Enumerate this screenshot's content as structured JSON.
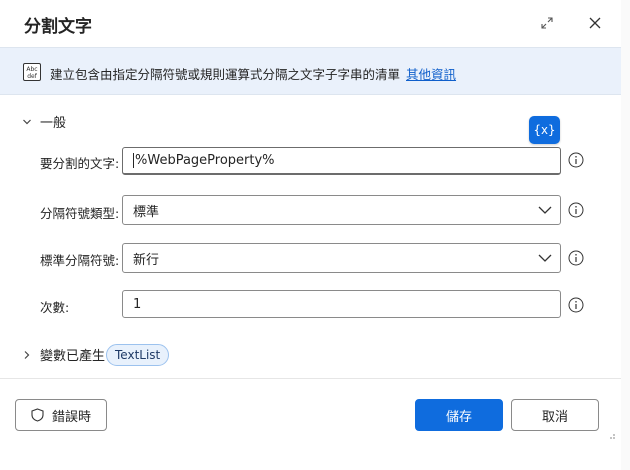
{
  "dialog": {
    "title": "分割文字",
    "expand_icon": "expand-icon",
    "close_icon": "close-icon"
  },
  "banner": {
    "icon": "text-abc-icon",
    "icon_text_top": "Abc",
    "icon_text_bottom": "def",
    "text": "建立包含由指定分隔符號或規則運算式分隔之文字子字串的清單",
    "link": "其他資訊"
  },
  "section": {
    "label": "一般",
    "var_button_label": "{x}"
  },
  "fields": {
    "text_to_split": {
      "label": "要分割的文字:",
      "value": "%WebPageProperty%"
    },
    "delimiter_type": {
      "label": "分隔符號類型:",
      "value": "標準"
    },
    "standard_delimiter": {
      "label": "標準分隔符號:",
      "value": "新行"
    },
    "times": {
      "label": "次數:",
      "value": "1"
    }
  },
  "variables": {
    "label": "變數已產生",
    "chip": "TextList"
  },
  "footer": {
    "on_error_label": "錯誤時",
    "save_label": "儲存",
    "cancel_label": "取消"
  },
  "colors": {
    "accent": "#0f6cde",
    "banner_bg": "#eaf1fb",
    "link": "#0f5fcb",
    "chip_bg": "#e8f1fc"
  }
}
